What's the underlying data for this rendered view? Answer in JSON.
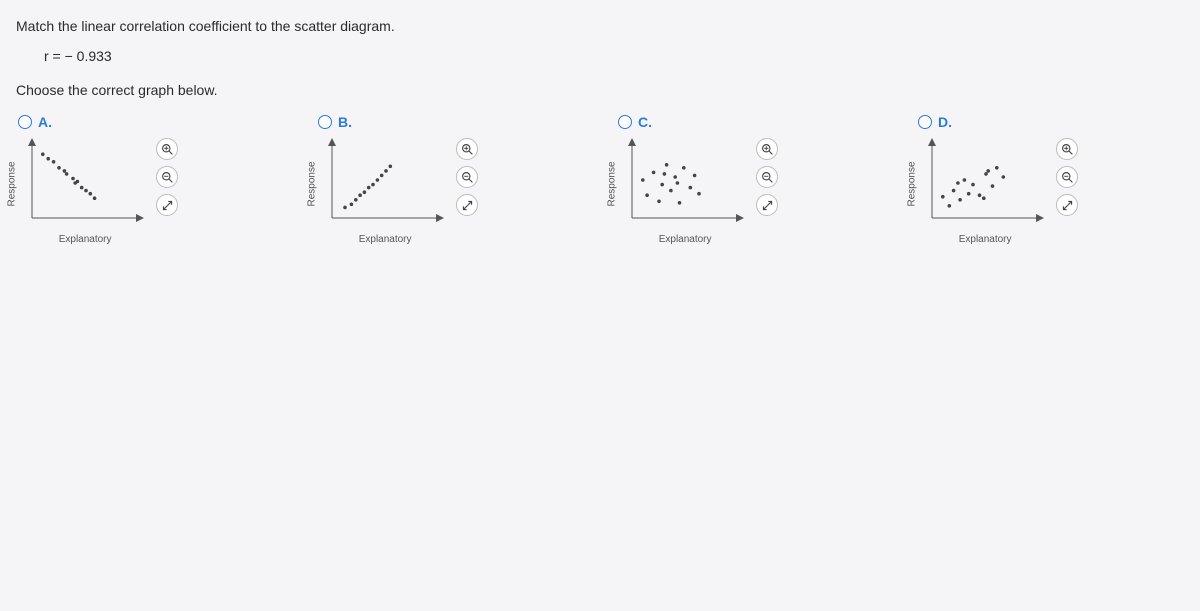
{
  "question": "Match the linear correlation coefficient to the scatter diagram.",
  "coeff_text": "r = − 0.933",
  "instruction": "Choose the correct graph below.",
  "axis_y": "Response",
  "axis_x": "Explanatory",
  "choices": {
    "A": {
      "label": "A."
    },
    "B": {
      "label": "B."
    },
    "C": {
      "label": "C."
    },
    "D": {
      "label": "D."
    }
  },
  "chart_data": [
    {
      "id": "A",
      "type": "scatter",
      "xlabel": "Explanatory",
      "ylabel": "Response",
      "xlim": [
        0,
        10
      ],
      "ylim": [
        0,
        10
      ],
      "description": "strong negative correlation r ≈ -0.933",
      "series": [
        {
          "name": "points",
          "x": [
            1.0,
            1.5,
            2.0,
            2.5,
            3.0,
            3.2,
            3.8,
            4.0,
            4.2,
            4.6,
            5.0,
            5.4,
            5.8
          ],
          "y": [
            8.4,
            7.8,
            7.4,
            6.6,
            6.2,
            5.8,
            5.2,
            4.6,
            4.8,
            4.0,
            3.6,
            3.2,
            2.6
          ]
        }
      ]
    },
    {
      "id": "B",
      "type": "scatter",
      "xlabel": "Explanatory",
      "ylabel": "Response",
      "xlim": [
        0,
        10
      ],
      "ylim": [
        0,
        10
      ],
      "description": "strong positive correlation r ≈ 0.9",
      "series": [
        {
          "name": "points",
          "x": [
            1.2,
            1.8,
            2.2,
            2.6,
            3.0,
            3.4,
            3.8,
            4.2,
            4.6,
            5.0,
            5.4
          ],
          "y": [
            1.4,
            1.8,
            2.4,
            3.0,
            3.4,
            4.0,
            4.4,
            5.0,
            5.6,
            6.2,
            6.8
          ]
        }
      ]
    },
    {
      "id": "C",
      "type": "scatter",
      "xlabel": "Explanatory",
      "ylabel": "Response",
      "xlim": [
        0,
        10
      ],
      "ylim": [
        0,
        10
      ],
      "description": "no clear correlation r ≈ 0",
      "series": [
        {
          "name": "points",
          "x": [
            1.0,
            1.4,
            2.0,
            2.5,
            2.8,
            3.2,
            3.6,
            4.0,
            4.4,
            4.8,
            5.4,
            5.8,
            6.2,
            3.0,
            4.2
          ],
          "y": [
            5.0,
            3.0,
            6.0,
            2.2,
            4.4,
            7.0,
            3.6,
            5.4,
            2.0,
            6.6,
            4.0,
            5.6,
            3.2,
            5.8,
            4.6
          ]
        }
      ]
    },
    {
      "id": "D",
      "type": "scatter",
      "xlabel": "Explanatory",
      "ylabel": "Response",
      "xlim": [
        0,
        10
      ],
      "ylim": [
        0,
        10
      ],
      "description": "weak positive correlation r ≈ 0.5",
      "series": [
        {
          "name": "points",
          "x": [
            1.0,
            1.6,
            2.0,
            2.6,
            3.0,
            3.4,
            3.8,
            4.4,
            5.0,
            5.6,
            6.0,
            6.6,
            4.8,
            2.4,
            5.2
          ],
          "y": [
            2.8,
            1.6,
            3.6,
            2.4,
            5.0,
            3.2,
            4.4,
            3.0,
            5.8,
            4.2,
            6.6,
            5.4,
            2.6,
            4.6,
            6.2
          ]
        }
      ]
    }
  ]
}
